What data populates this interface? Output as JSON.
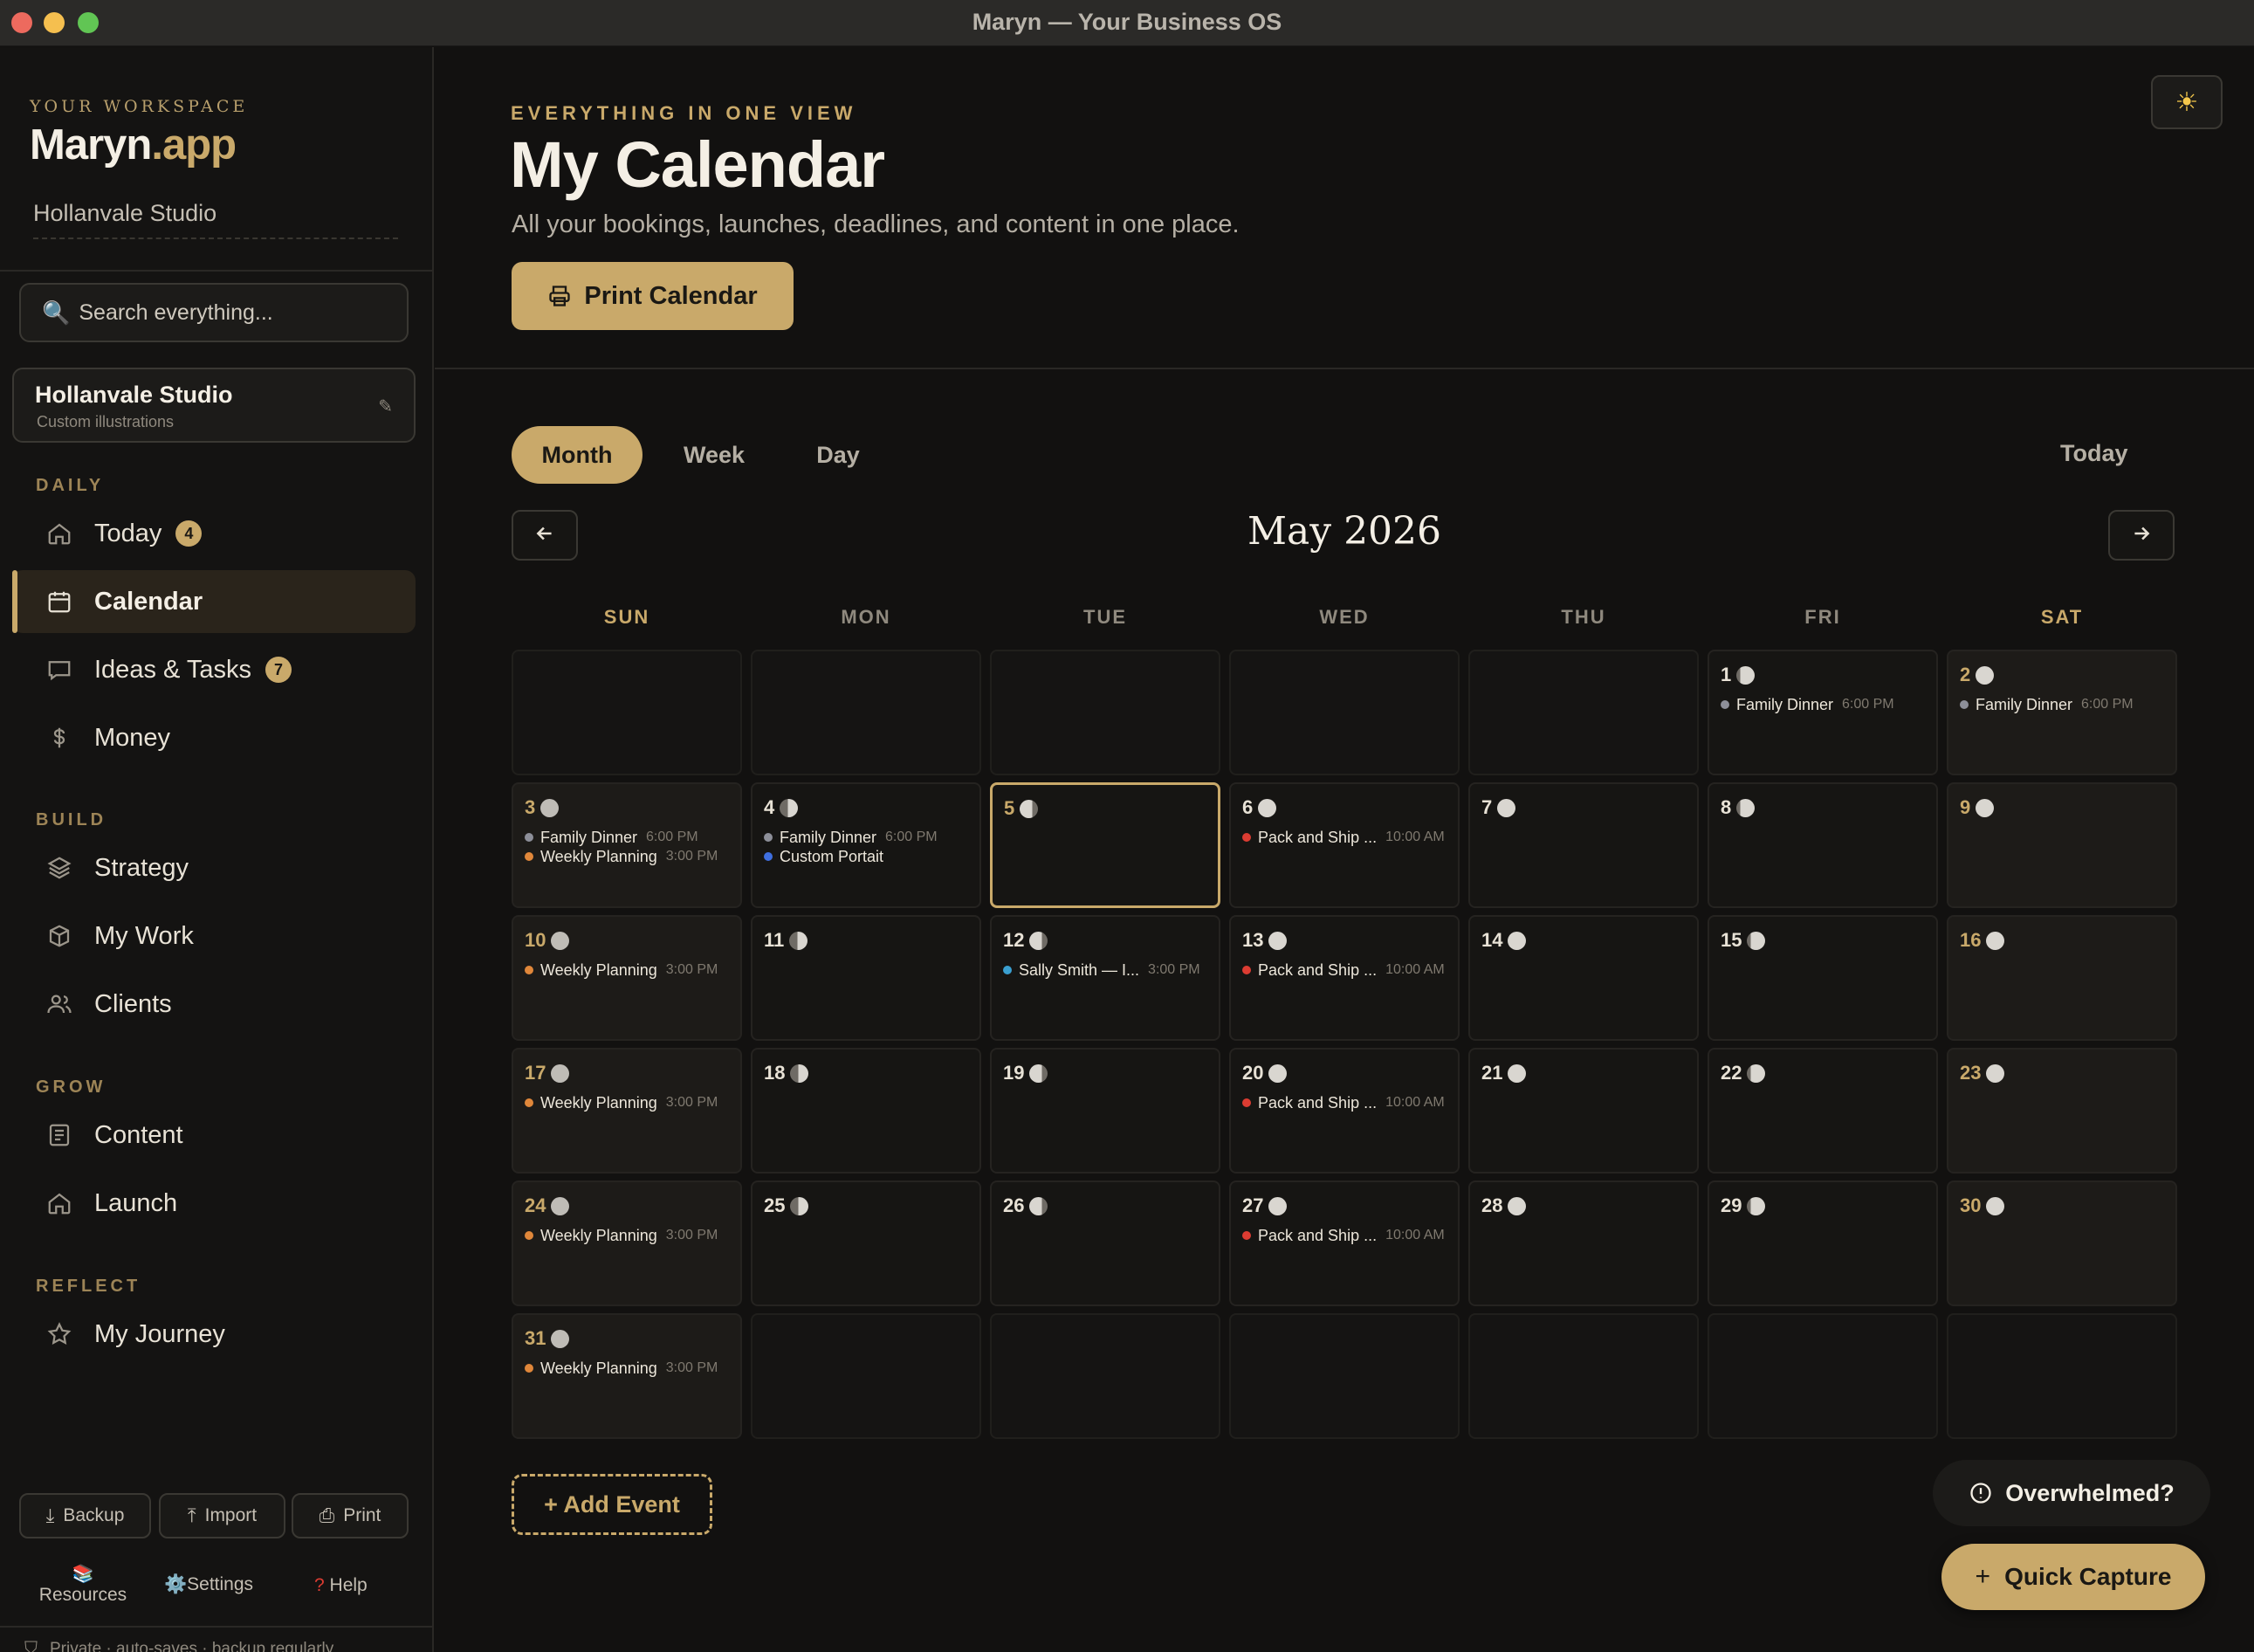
{
  "window": {
    "title": "Maryn — Your Business OS"
  },
  "sidebar": {
    "eyebrow": "YOUR WORKSPACE",
    "brand_main": "Maryn",
    "brand_suffix": ".app",
    "workspace_name": "Hollanvale Studio",
    "search_placeholder": "Search everything...",
    "studio": {
      "name": "Hollanvale Studio",
      "subtitle": "Custom illustrations",
      "edit_icon": "pencil-icon"
    },
    "sections": [
      {
        "label": "DAILY"
      },
      {
        "label": "BUILD"
      },
      {
        "label": "GROW"
      },
      {
        "label": "REFLECT"
      }
    ],
    "items": [
      {
        "label": "Today",
        "badge": "4",
        "icon": "home-icon"
      },
      {
        "label": "Calendar",
        "icon": "calendar-icon",
        "active": true
      },
      {
        "label": "Ideas & Tasks",
        "badge": "7",
        "icon": "chat-icon"
      },
      {
        "label": "Money",
        "icon": "currency-icon"
      },
      {
        "label": "Strategy",
        "icon": "layers-icon"
      },
      {
        "label": "My Work",
        "icon": "box-icon"
      },
      {
        "label": "Clients",
        "icon": "users-icon"
      },
      {
        "label": "Content",
        "icon": "document-icon"
      },
      {
        "label": "Launch",
        "icon": "home-icon"
      },
      {
        "label": "My Journey",
        "icon": "star-icon"
      }
    ],
    "footer": {
      "backup": "Backup",
      "import": "Import",
      "print": "Print",
      "resources": "Resources",
      "settings": "Settings",
      "help": "Help",
      "privacy": "Private · auto-saves · backup regularly"
    }
  },
  "header": {
    "eyebrow": "EVERYTHING IN ONE VIEW",
    "title": "My Calendar",
    "subtitle": "All your bookings, launches, deadlines, and content in one place.",
    "print_button": "Print Calendar",
    "theme_icon": "sun-icon"
  },
  "calendar": {
    "views": [
      "Month",
      "Week",
      "Day"
    ],
    "active_view": "Month",
    "today_label": "Today",
    "month_title": "May 2026",
    "weekdays": [
      "SUN",
      "MON",
      "TUE",
      "WED",
      "THU",
      "FRI",
      "SAT"
    ],
    "today_date": 5,
    "event_colors": {
      "Family Dinner": "#8d8f99",
      "Weekly Planning": "#e0873a",
      "Custom Portait": "#3f6fe0",
      "Pack and Ship ...": "#dc3c32",
      "Sally Smith — I...": "#3a9fd0"
    },
    "days": [
      {
        "d": 1,
        "events": [
          {
            "name": "Family Dinner",
            "time": "6:00 PM"
          }
        ]
      },
      {
        "d": 2,
        "events": [
          {
            "name": "Family Dinner",
            "time": "6:00 PM"
          }
        ]
      },
      {
        "d": 3,
        "events": [
          {
            "name": "Family Dinner",
            "time": "6:00 PM"
          },
          {
            "name": "Weekly Planning",
            "time": "3:00 PM"
          }
        ]
      },
      {
        "d": 4,
        "events": [
          {
            "name": "Family Dinner",
            "time": "6:00 PM"
          },
          {
            "name": "Custom Portait",
            "time": ""
          }
        ]
      },
      {
        "d": 5,
        "events": []
      },
      {
        "d": 6,
        "events": [
          {
            "name": "Pack and Ship ...",
            "time": "10:00 AM"
          }
        ]
      },
      {
        "d": 7,
        "events": []
      },
      {
        "d": 8,
        "events": []
      },
      {
        "d": 9,
        "events": []
      },
      {
        "d": 10,
        "events": [
          {
            "name": "Weekly Planning",
            "time": "3:00 PM"
          }
        ]
      },
      {
        "d": 11,
        "events": []
      },
      {
        "d": 12,
        "events": [
          {
            "name": "Sally Smith — I...",
            "time": "3:00 PM"
          }
        ]
      },
      {
        "d": 13,
        "events": [
          {
            "name": "Pack and Ship ...",
            "time": "10:00 AM"
          }
        ]
      },
      {
        "d": 14,
        "events": []
      },
      {
        "d": 15,
        "events": []
      },
      {
        "d": 16,
        "events": []
      },
      {
        "d": 17,
        "events": [
          {
            "name": "Weekly Planning",
            "time": "3:00 PM"
          }
        ]
      },
      {
        "d": 18,
        "events": []
      },
      {
        "d": 19,
        "events": []
      },
      {
        "d": 20,
        "events": [
          {
            "name": "Pack and Ship ...",
            "time": "10:00 AM"
          }
        ]
      },
      {
        "d": 21,
        "events": []
      },
      {
        "d": 22,
        "events": []
      },
      {
        "d": 23,
        "events": []
      },
      {
        "d": 24,
        "events": [
          {
            "name": "Weekly Planning",
            "time": "3:00 PM"
          }
        ]
      },
      {
        "d": 25,
        "events": []
      },
      {
        "d": 26,
        "events": []
      },
      {
        "d": 27,
        "events": [
          {
            "name": "Pack and Ship ...",
            "time": "10:00 AM"
          }
        ]
      },
      {
        "d": 28,
        "events": []
      },
      {
        "d": 29,
        "events": []
      },
      {
        "d": 30,
        "events": []
      },
      {
        "d": 31,
        "events": [
          {
            "name": "Weekly Planning",
            "time": "3:00 PM"
          }
        ]
      }
    ],
    "add_event": "+ Add Event"
  },
  "floating": {
    "overwhelmed": "Overwhelmed?",
    "quick_capture": "Quick Capture"
  }
}
